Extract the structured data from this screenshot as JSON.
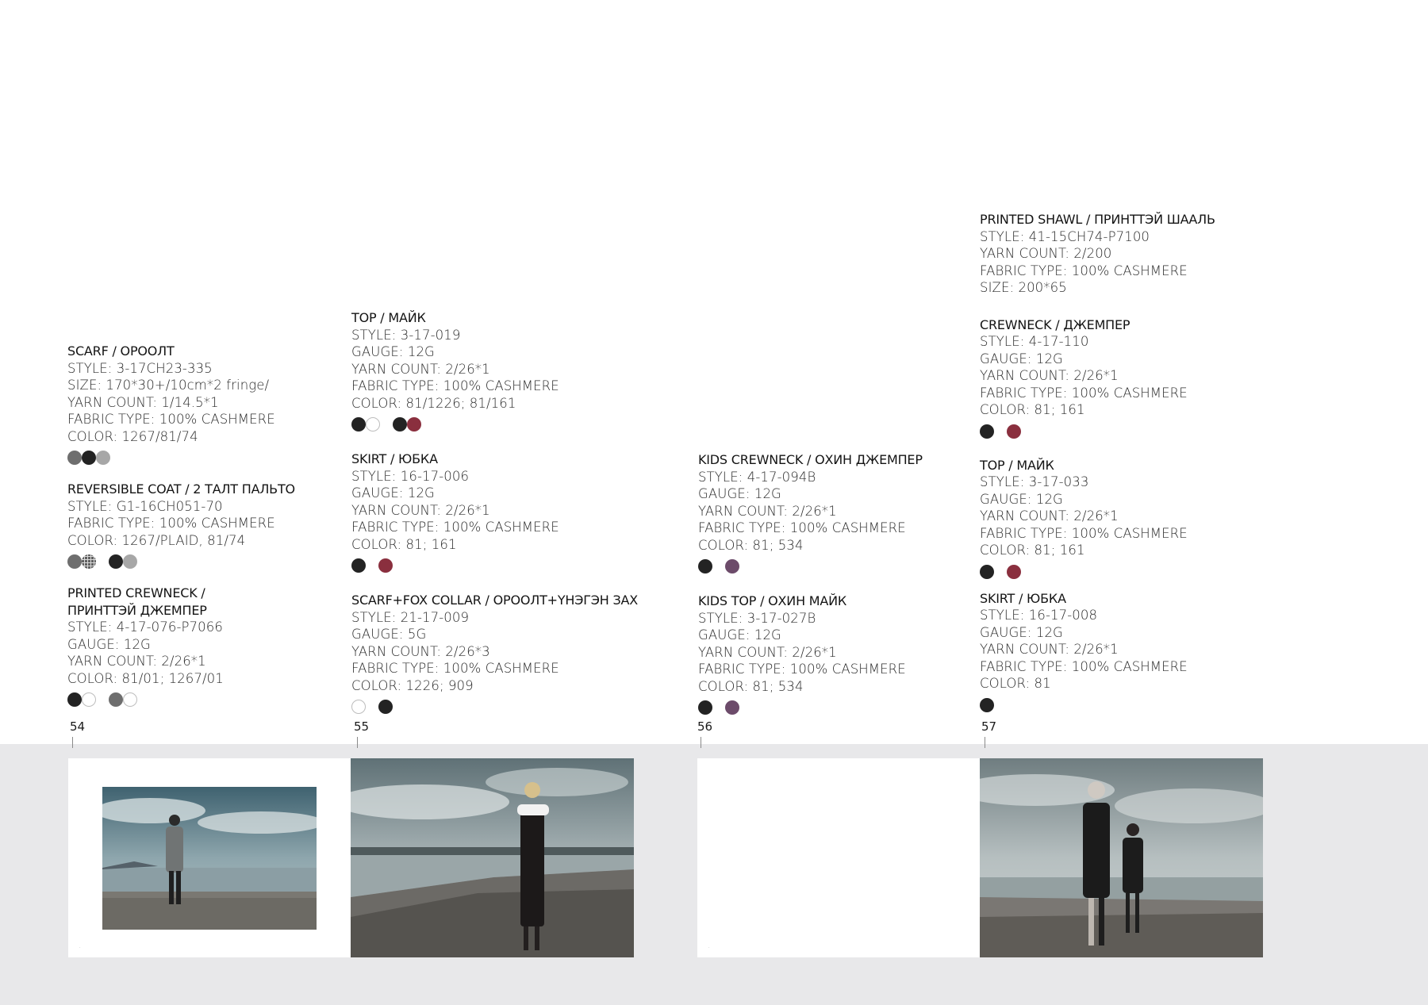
{
  "columns": [
    {
      "blocks": [
        {
          "title": "SCARF / ОРООЛТ",
          "lines": [
            "STYLE: 3-17CH23-335",
            "SIZE: 170*30+/10cm*2 fringe/",
            "YARN COUNT: 1/14.5*1",
            "FABRIC TYPE: 100% CASHMERE",
            "COLOR: 1267/81/74"
          ]
        },
        {
          "title": "REVERSIBLE COAT / 2 ТАЛТ ПАЛЬТО",
          "lines": [
            "STYLE: G1-16CH051-70",
            "FABRIC TYPE: 100% CASHMERE",
            "COLOR: 1267/PLAID, 81/74"
          ]
        },
        {
          "title": "PRINTED CREWNECK /",
          "title2": "ПРИНТТЭЙ ДЖЕМПЕР",
          "lines": [
            "STYLE: 4-17-076-P7066",
            "GAUGE: 12G",
            "YARN COUNT: 2/26*1",
            "COLOR: 81/01; 1267/01"
          ]
        }
      ]
    },
    {
      "blocks": [
        {
          "title": "TOP / МАЙК",
          "lines": [
            "STYLE: 3-17-019",
            "GAUGE: 12G",
            "YARN COUNT: 2/26*1",
            "FABRIC TYPE: 100% CASHMERE",
            "COLOR: 81/1226; 81/161"
          ]
        },
        {
          "title": "SKIRT / ЮБКА",
          "lines": [
            "STYLE: 16-17-006",
            "GAUGE: 12G",
            "YARN COUNT: 2/26*1",
            "FABRIC TYPE: 100% CASHMERE",
            "COLOR: 81; 161"
          ]
        },
        {
          "title": "SCARF+FOX COLLAR / ОРООЛТ+ҮНЭГЭН ЗАХ",
          "lines": [
            "STYLE: 21-17-009",
            "GAUGE: 5G",
            "YARN COUNT: 2/26*3",
            "FABRIC TYPE: 100% CASHMERE",
            "COLOR: 1226; 909"
          ]
        }
      ]
    },
    {
      "blocks": [
        {
          "title": "KIDS CREWNECK / ОХИН ДЖЕМПЕР",
          "lines": [
            "STYLE: 4-17-094B",
            "GAUGE: 12G",
            "YARN COUNT: 2/26*1",
            "FABRIC TYPE: 100% CASHMERE",
            "COLOR: 81; 534"
          ]
        },
        {
          "title": "KIDS TOP / ОХИН МАЙК",
          "lines": [
            "STYLE: 3-17-027B",
            "GAUGE: 12G",
            "YARN COUNT: 2/26*1",
            "FABRIC TYPE: 100% CASHMERE",
            "COLOR: 81; 534"
          ]
        }
      ]
    },
    {
      "blocks": [
        {
          "title": "PRINTED SHAWL / ПРИНТТЭЙ ШААЛЬ",
          "lines": [
            "STYLE: 41-15CH74-P7100",
            "YARN COUNT: 2/200",
            "FABRIC TYPE: 100% CASHMERE",
            "SIZE: 200*65"
          ]
        },
        {
          "title": "CREWNECK / ДЖЕМПЕР",
          "lines": [
            "STYLE: 4-17-110",
            "GAUGE: 12G",
            "YARN COUNT: 2/26*1",
            "FABRIC TYPE: 100% CASHMERE",
            "COLOR: 81; 161"
          ]
        },
        {
          "title": "TOP / МАЙК",
          "lines": [
            "STYLE: 3-17-033",
            "GAUGE: 12G",
            "YARN COUNT: 2/26*1",
            "FABRIC TYPE: 100% CASHMERE",
            "COLOR: 81; 161"
          ]
        },
        {
          "title": "SKIRT / ЮБКА",
          "lines": [
            "STYLE: 16-17-008",
            "GAUGE: 12G",
            "YARN COUNT: 2/26*1",
            "FABRIC TYPE: 100% CASHMERE",
            "COLOR: 81"
          ]
        }
      ]
    }
  ],
  "swatch_colors": {
    "black": "#232323",
    "white": "#ffffff",
    "grey": "#6e6e6e",
    "light_grey": "#a7a7a7",
    "burgundy": "#8a2f3e",
    "purple": "#6c4b6a"
  },
  "page_numbers": [
    "54",
    "55",
    "56",
    "57"
  ],
  "colors": {
    "band": "#e8e8ea",
    "text": "#1e1e1e"
  }
}
